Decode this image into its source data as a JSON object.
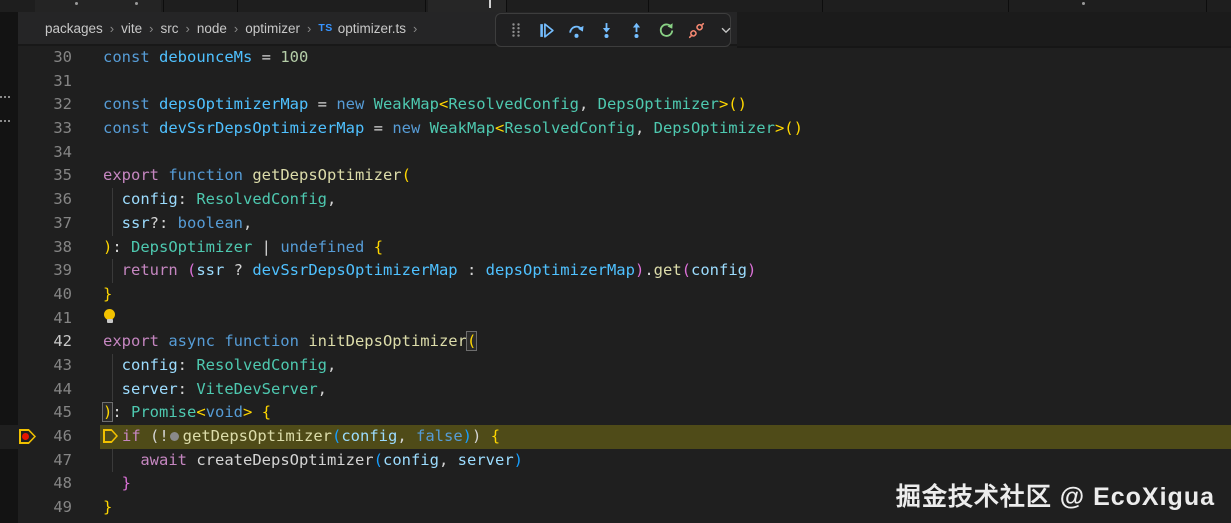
{
  "breadcrumb": {
    "separator": "›",
    "items": [
      {
        "label": "packages"
      },
      {
        "label": "vite"
      },
      {
        "label": "src"
      },
      {
        "label": "node"
      },
      {
        "label": "optimizer"
      },
      {
        "label": "optimizer.ts",
        "badge": "TS"
      }
    ]
  },
  "toolbar": {
    "icons": [
      "gripper",
      "continue",
      "step-over",
      "step-into",
      "step-out",
      "restart",
      "disconnect",
      "chevron-down"
    ]
  },
  "palette": {
    "editor_bg": "#1f1f1f",
    "debug_line_highlight": "#4f4b18",
    "keyword_blue": "#569cd6",
    "control_purple": "#c586c0",
    "function_yellow": "#dcdcaa",
    "type_teal": "#4ec9b0",
    "param_blue": "#9cdcfe",
    "const_cyan": "#4fc1ff",
    "number_green": "#b5cea8",
    "bracket_gold": "#ffd700",
    "bracket_pink": "#da70d6",
    "bracket_blue": "#179fff",
    "debug_continue_blue": "#75beff",
    "restart_green": "#89d185",
    "disconnect_red": "#f48771",
    "breakpoint_red": "#e51400",
    "current_frame_yellow": "#f0c000",
    "ts_badge_blue": "#3794ff"
  },
  "editor": {
    "lines": [
      {
        "n": 30,
        "t": [
          [
            "kw",
            "const "
          ],
          [
            "cvar",
            "debounceMs"
          ],
          [
            "fg",
            " = "
          ],
          [
            "num",
            "100"
          ]
        ]
      },
      {
        "n": 31,
        "t": []
      },
      {
        "n": 32,
        "t": [
          [
            "kw",
            "const "
          ],
          [
            "cvar",
            "depsOptimizerMap"
          ],
          [
            "fg",
            " = "
          ],
          [
            "kw",
            "new "
          ],
          [
            "type",
            "WeakMap"
          ],
          [
            "b1",
            "<"
          ],
          [
            "type",
            "ResolvedConfig"
          ],
          [
            "fg",
            ", "
          ],
          [
            "type",
            "DepsOptimizer"
          ],
          [
            "b1",
            ">()"
          ]
        ]
      },
      {
        "n": 33,
        "t": [
          [
            "kw",
            "const "
          ],
          [
            "cvar",
            "devSsrDepsOptimizerMap"
          ],
          [
            "fg",
            " = "
          ],
          [
            "kw",
            "new "
          ],
          [
            "type",
            "WeakMap"
          ],
          [
            "b1",
            "<"
          ],
          [
            "type",
            "ResolvedConfig"
          ],
          [
            "fg",
            ", "
          ],
          [
            "type",
            "DepsOptimizer"
          ],
          [
            "b1",
            ">()"
          ]
        ]
      },
      {
        "n": 34,
        "t": []
      },
      {
        "n": 35,
        "t": [
          [
            "ctrl",
            "export "
          ],
          [
            "kw",
            "function "
          ],
          [
            "fn",
            "getDepsOptimizer"
          ],
          [
            "b1",
            "("
          ]
        ]
      },
      {
        "n": 36,
        "guide": true,
        "t": [
          [
            "fg",
            "  "
          ],
          [
            "var",
            "config"
          ],
          [
            "fg",
            ": "
          ],
          [
            "type",
            "ResolvedConfig"
          ],
          [
            "fg",
            ","
          ]
        ]
      },
      {
        "n": 37,
        "guide": true,
        "t": [
          [
            "fg",
            "  "
          ],
          [
            "var",
            "ssr"
          ],
          [
            "fg",
            "?: "
          ],
          [
            "kw",
            "boolean"
          ],
          [
            "fg",
            ","
          ]
        ]
      },
      {
        "n": 38,
        "t": [
          [
            "b1",
            ")"
          ],
          [
            "fg",
            ": "
          ],
          [
            "type",
            "DepsOptimizer"
          ],
          [
            "fg",
            " | "
          ],
          [
            "kw",
            "undefined"
          ],
          [
            "fg",
            " "
          ],
          [
            "b1",
            "{"
          ]
        ]
      },
      {
        "n": 39,
        "guide": true,
        "t": [
          [
            "fg",
            "  "
          ],
          [
            "ctrl",
            "return "
          ],
          [
            "b2",
            "("
          ],
          [
            "var",
            "ssr"
          ],
          [
            "fg",
            " ? "
          ],
          [
            "cvar",
            "devSsrDepsOptimizerMap"
          ],
          [
            "fg",
            " : "
          ],
          [
            "cvar",
            "depsOptimizerMap"
          ],
          [
            "b2",
            ")"
          ],
          [
            "fg",
            "."
          ],
          [
            "fn",
            "get"
          ],
          [
            "b2",
            "("
          ],
          [
            "var",
            "config"
          ],
          [
            "b2",
            ")"
          ]
        ]
      },
      {
        "n": 40,
        "t": [
          [
            "b1",
            "}"
          ]
        ]
      },
      {
        "n": 41,
        "bulb": true,
        "t": []
      },
      {
        "n": 42,
        "cur": true,
        "t": [
          [
            "ctrl",
            "export "
          ],
          [
            "kw",
            "async function "
          ],
          [
            "fn",
            "initDepsOptimizer"
          ],
          [
            "b1x",
            "("
          ]
        ]
      },
      {
        "n": 43,
        "guide": true,
        "t": [
          [
            "fg",
            "  "
          ],
          [
            "var",
            "config"
          ],
          [
            "fg",
            ": "
          ],
          [
            "type",
            "ResolvedConfig"
          ],
          [
            "fg",
            ","
          ]
        ]
      },
      {
        "n": 44,
        "guide": true,
        "t": [
          [
            "fg",
            "  "
          ],
          [
            "var",
            "server"
          ],
          [
            "fg",
            ": "
          ],
          [
            "type",
            "ViteDevServer"
          ],
          [
            "fg",
            ","
          ]
        ]
      },
      {
        "n": 45,
        "t": [
          [
            "b1x",
            ")"
          ],
          [
            "fg",
            ": "
          ],
          [
            "type",
            "Promise"
          ],
          [
            "b1",
            "<"
          ],
          [
            "kw",
            "void"
          ],
          [
            "b1",
            ">"
          ],
          [
            "fg",
            " "
          ],
          [
            "b1",
            "{"
          ]
        ]
      },
      {
        "n": 46,
        "hl": true,
        "bp": true,
        "t": [
          [
            "dbg",
            ""
          ],
          [
            "ctrl",
            "if "
          ],
          [
            "fg",
            "(!"
          ],
          [
            "dot",
            ""
          ],
          [
            "fn",
            "getDepsOptimizer"
          ],
          [
            "b3",
            "("
          ],
          [
            "var",
            "config"
          ],
          [
            "fg",
            ", "
          ],
          [
            "kw",
            "false"
          ],
          [
            "b3",
            ")"
          ],
          [
            "fg",
            ") "
          ],
          [
            "b1",
            "{"
          ]
        ]
      },
      {
        "n": 47,
        "guide": true,
        "t": [
          [
            "fg",
            "    "
          ],
          [
            "ctrl",
            "await "
          ],
          [
            "fg",
            "createDepsOptimizer"
          ],
          [
            "b3",
            "("
          ],
          [
            "var",
            "config"
          ],
          [
            "fg",
            ", "
          ],
          [
            "var",
            "server"
          ],
          [
            "b3",
            ")"
          ]
        ]
      },
      {
        "n": 48,
        "t": [
          [
            "b2",
            "  }"
          ]
        ]
      },
      {
        "n": 49,
        "t": [
          [
            "b1",
            "}"
          ]
        ]
      }
    ]
  },
  "watermark": {
    "text": "掘金技术社区 @ EcoXigua"
  }
}
